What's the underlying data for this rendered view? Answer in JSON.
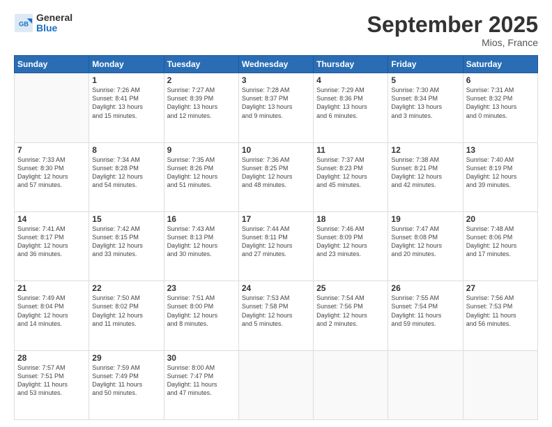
{
  "header": {
    "logo_general": "General",
    "logo_blue": "Blue",
    "month": "September 2025",
    "location": "Mios, France"
  },
  "days_of_week": [
    "Sunday",
    "Monday",
    "Tuesday",
    "Wednesday",
    "Thursday",
    "Friday",
    "Saturday"
  ],
  "weeks": [
    [
      {
        "day": "",
        "info": ""
      },
      {
        "day": "1",
        "info": "Sunrise: 7:26 AM\nSunset: 8:41 PM\nDaylight: 13 hours\nand 15 minutes."
      },
      {
        "day": "2",
        "info": "Sunrise: 7:27 AM\nSunset: 8:39 PM\nDaylight: 13 hours\nand 12 minutes."
      },
      {
        "day": "3",
        "info": "Sunrise: 7:28 AM\nSunset: 8:37 PM\nDaylight: 13 hours\nand 9 minutes."
      },
      {
        "day": "4",
        "info": "Sunrise: 7:29 AM\nSunset: 8:36 PM\nDaylight: 13 hours\nand 6 minutes."
      },
      {
        "day": "5",
        "info": "Sunrise: 7:30 AM\nSunset: 8:34 PM\nDaylight: 13 hours\nand 3 minutes."
      },
      {
        "day": "6",
        "info": "Sunrise: 7:31 AM\nSunset: 8:32 PM\nDaylight: 13 hours\nand 0 minutes."
      }
    ],
    [
      {
        "day": "7",
        "info": "Sunrise: 7:33 AM\nSunset: 8:30 PM\nDaylight: 12 hours\nand 57 minutes."
      },
      {
        "day": "8",
        "info": "Sunrise: 7:34 AM\nSunset: 8:28 PM\nDaylight: 12 hours\nand 54 minutes."
      },
      {
        "day": "9",
        "info": "Sunrise: 7:35 AM\nSunset: 8:26 PM\nDaylight: 12 hours\nand 51 minutes."
      },
      {
        "day": "10",
        "info": "Sunrise: 7:36 AM\nSunset: 8:25 PM\nDaylight: 12 hours\nand 48 minutes."
      },
      {
        "day": "11",
        "info": "Sunrise: 7:37 AM\nSunset: 8:23 PM\nDaylight: 12 hours\nand 45 minutes."
      },
      {
        "day": "12",
        "info": "Sunrise: 7:38 AM\nSunset: 8:21 PM\nDaylight: 12 hours\nand 42 minutes."
      },
      {
        "day": "13",
        "info": "Sunrise: 7:40 AM\nSunset: 8:19 PM\nDaylight: 12 hours\nand 39 minutes."
      }
    ],
    [
      {
        "day": "14",
        "info": "Sunrise: 7:41 AM\nSunset: 8:17 PM\nDaylight: 12 hours\nand 36 minutes."
      },
      {
        "day": "15",
        "info": "Sunrise: 7:42 AM\nSunset: 8:15 PM\nDaylight: 12 hours\nand 33 minutes."
      },
      {
        "day": "16",
        "info": "Sunrise: 7:43 AM\nSunset: 8:13 PM\nDaylight: 12 hours\nand 30 minutes."
      },
      {
        "day": "17",
        "info": "Sunrise: 7:44 AM\nSunset: 8:11 PM\nDaylight: 12 hours\nand 27 minutes."
      },
      {
        "day": "18",
        "info": "Sunrise: 7:46 AM\nSunset: 8:09 PM\nDaylight: 12 hours\nand 23 minutes."
      },
      {
        "day": "19",
        "info": "Sunrise: 7:47 AM\nSunset: 8:08 PM\nDaylight: 12 hours\nand 20 minutes."
      },
      {
        "day": "20",
        "info": "Sunrise: 7:48 AM\nSunset: 8:06 PM\nDaylight: 12 hours\nand 17 minutes."
      }
    ],
    [
      {
        "day": "21",
        "info": "Sunrise: 7:49 AM\nSunset: 8:04 PM\nDaylight: 12 hours\nand 14 minutes."
      },
      {
        "day": "22",
        "info": "Sunrise: 7:50 AM\nSunset: 8:02 PM\nDaylight: 12 hours\nand 11 minutes."
      },
      {
        "day": "23",
        "info": "Sunrise: 7:51 AM\nSunset: 8:00 PM\nDaylight: 12 hours\nand 8 minutes."
      },
      {
        "day": "24",
        "info": "Sunrise: 7:53 AM\nSunset: 7:58 PM\nDaylight: 12 hours\nand 5 minutes."
      },
      {
        "day": "25",
        "info": "Sunrise: 7:54 AM\nSunset: 7:56 PM\nDaylight: 12 hours\nand 2 minutes."
      },
      {
        "day": "26",
        "info": "Sunrise: 7:55 AM\nSunset: 7:54 PM\nDaylight: 11 hours\nand 59 minutes."
      },
      {
        "day": "27",
        "info": "Sunrise: 7:56 AM\nSunset: 7:53 PM\nDaylight: 11 hours\nand 56 minutes."
      }
    ],
    [
      {
        "day": "28",
        "info": "Sunrise: 7:57 AM\nSunset: 7:51 PM\nDaylight: 11 hours\nand 53 minutes."
      },
      {
        "day": "29",
        "info": "Sunrise: 7:59 AM\nSunset: 7:49 PM\nDaylight: 11 hours\nand 50 minutes."
      },
      {
        "day": "30",
        "info": "Sunrise: 8:00 AM\nSunset: 7:47 PM\nDaylight: 11 hours\nand 47 minutes."
      },
      {
        "day": "",
        "info": ""
      },
      {
        "day": "",
        "info": ""
      },
      {
        "day": "",
        "info": ""
      },
      {
        "day": "",
        "info": ""
      }
    ]
  ]
}
